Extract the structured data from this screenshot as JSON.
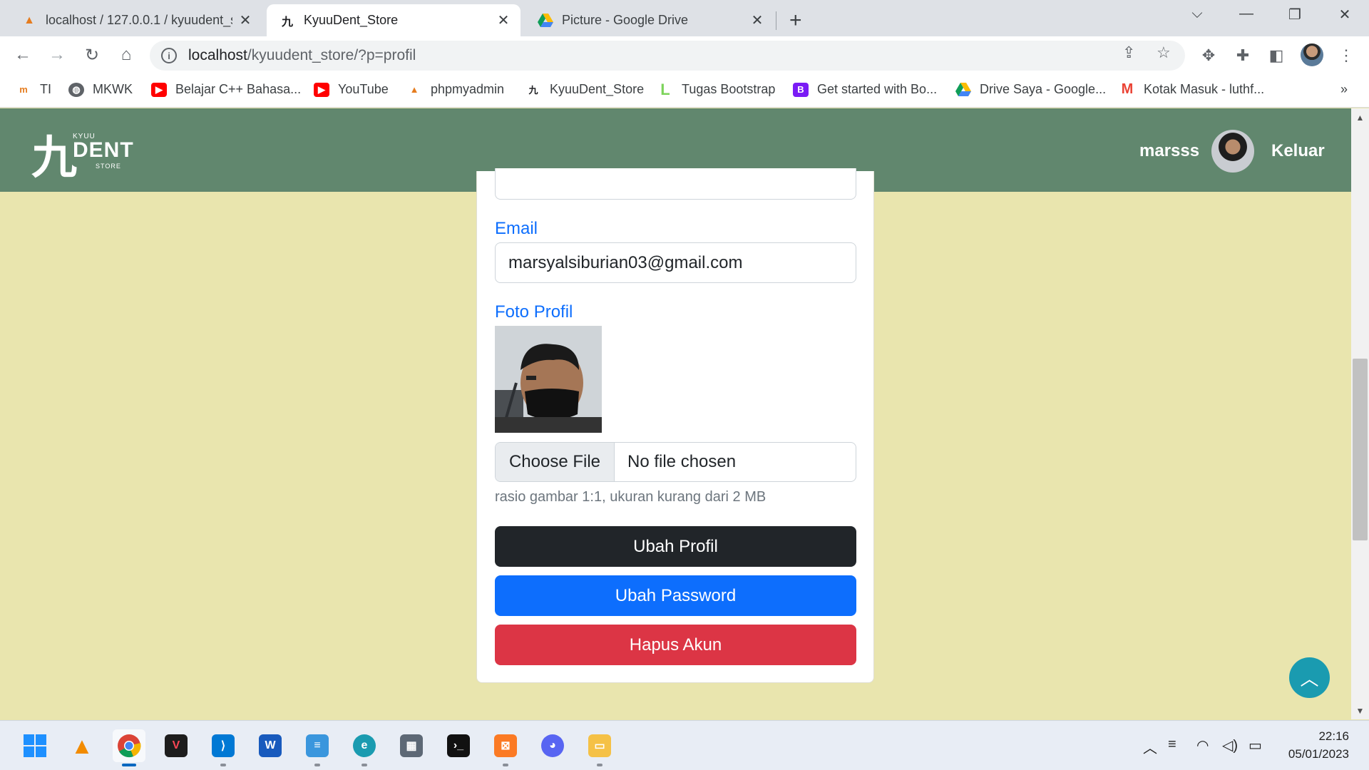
{
  "browser": {
    "tabs": [
      {
        "title": "localhost / 127.0.0.1 / kyuudent_s",
        "active": false
      },
      {
        "title": "KyuuDent_Store",
        "active": true
      },
      {
        "title": "Picture - Google Drive",
        "active": false
      }
    ],
    "url_host": "localhost",
    "url_path": "/kyuudent_store/?p=profil",
    "bookmarks": [
      {
        "label": "TI",
        "icon": "ti-icon"
      },
      {
        "label": "MKWK",
        "icon": "globe-icon"
      },
      {
        "label": "Belajar C++ Bahasa...",
        "icon": "youtube-icon"
      },
      {
        "label": "YouTube",
        "icon": "youtube-icon"
      },
      {
        "label": "phpmyadmin",
        "icon": "phpmyadmin-icon"
      },
      {
        "label": "KyuuDent_Store",
        "icon": "kyuu-icon"
      },
      {
        "label": "Tugas Bootstrap",
        "icon": "bracket-icon"
      },
      {
        "label": "Get started with Bo...",
        "icon": "bootstrap-icon"
      },
      {
        "label": "Drive Saya - Google...",
        "icon": "drive-icon"
      },
      {
        "label": "Kotak Masuk - luthf...",
        "icon": "gmail-icon"
      }
    ],
    "bookmarks_overflow": "»"
  },
  "site": {
    "logo": {
      "kanji": "九",
      "kyuu": "KYUU",
      "dent": "DENT",
      "store": "STORE"
    },
    "username": "marsss",
    "logout": "Keluar"
  },
  "form": {
    "email_label": "Email",
    "email_value": "marsyalsiburian03@gmail.com",
    "photo_label": "Foto Profil",
    "choose_file": "Choose File",
    "no_file": "No file chosen",
    "hint": "rasio gambar 1:1, ukuran kurang dari 2 MB",
    "btn_update_profile": "Ubah Profil",
    "btn_change_password": "Ubah Password",
    "btn_delete_account": "Hapus Akun"
  },
  "taskbar": {
    "apps": [
      "windows-start",
      "vlc",
      "chrome",
      "valorant",
      "vscode",
      "word",
      "notepad",
      "edge",
      "calculator",
      "terminal",
      "xampp",
      "discord",
      "file-explorer"
    ],
    "time": "22:16",
    "date": "05/01/2023"
  },
  "colors": {
    "page_bg": "#e9e5ae",
    "navbar": "#61876e",
    "primary": "#0d6efd",
    "danger": "#dc3545",
    "dark": "#212529",
    "to_top": "#1a9bb0"
  }
}
